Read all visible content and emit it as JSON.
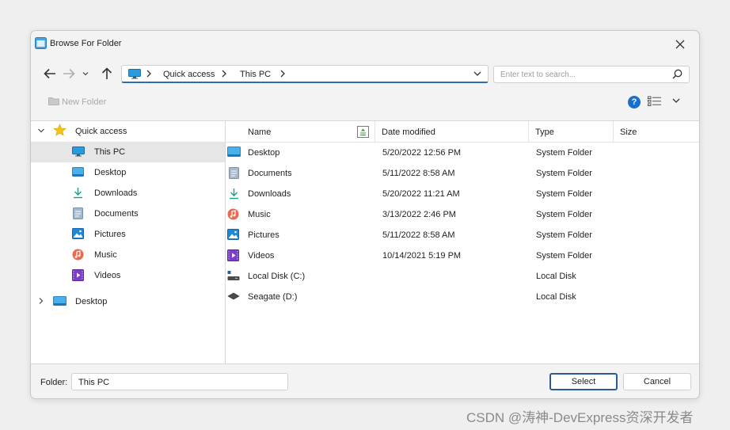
{
  "window": {
    "title": "Browse For Folder"
  },
  "address": {
    "crumbs": [
      "Quick access",
      "This PC"
    ]
  },
  "search": {
    "placeholder": "Enter text to search..."
  },
  "toolbar": {
    "new_folder_label": "New Folder",
    "help_label": "?"
  },
  "tree": {
    "items": [
      {
        "label": "Quick access",
        "icon": "star-icon"
      },
      {
        "label": "This PC",
        "icon": "monitor-icon",
        "selected": true
      },
      {
        "label": "Desktop",
        "icon": "desktop-icon"
      },
      {
        "label": "Downloads",
        "icon": "download-icon"
      },
      {
        "label": "Documents",
        "icon": "documents-icon"
      },
      {
        "label": "Pictures",
        "icon": "pictures-icon"
      },
      {
        "label": "Music",
        "icon": "music-icon"
      },
      {
        "label": "Videos",
        "icon": "videos-icon"
      },
      {
        "label": "Desktop",
        "icon": "desktop-icon"
      }
    ]
  },
  "files": {
    "columns": [
      "Name",
      "Date modified",
      "Type",
      "Size"
    ],
    "rows": [
      {
        "name": "Desktop",
        "date": "5/20/2022 12:56 PM",
        "type": "System Folder",
        "icon": "desktop-icon"
      },
      {
        "name": "Documents",
        "date": "5/11/2022 8:58 AM",
        "type": "System Folder",
        "icon": "documents-icon"
      },
      {
        "name": "Downloads",
        "date": "5/20/2022 11:21 AM",
        "type": "System Folder",
        "icon": "download-icon"
      },
      {
        "name": "Music",
        "date": "3/13/2022 2:46 PM",
        "type": "System Folder",
        "icon": "music-icon"
      },
      {
        "name": "Pictures",
        "date": "5/11/2022 8:58 AM",
        "type": "System Folder",
        "icon": "pictures-icon"
      },
      {
        "name": "Videos",
        "date": "10/14/2021 5:19 PM",
        "type": "System Folder",
        "icon": "videos-icon"
      },
      {
        "name": "Local Disk (C:)",
        "date": "",
        "type": "Local Disk",
        "icon": "local-disk-icon"
      },
      {
        "name": "Seagate (D:)",
        "date": "",
        "type": "Local Disk",
        "icon": "external-drive-icon"
      }
    ]
  },
  "footer": {
    "folder_label": "Folder:",
    "folder_value": "This PC",
    "select_label": "Select",
    "cancel_label": "Cancel"
  },
  "watermark": "CSDN @涛神-DevExpress资深开发者",
  "colors": {
    "accent": "#2a6fb3",
    "help": "#1a6fd1",
    "selected_row": "#e6e6e6"
  }
}
